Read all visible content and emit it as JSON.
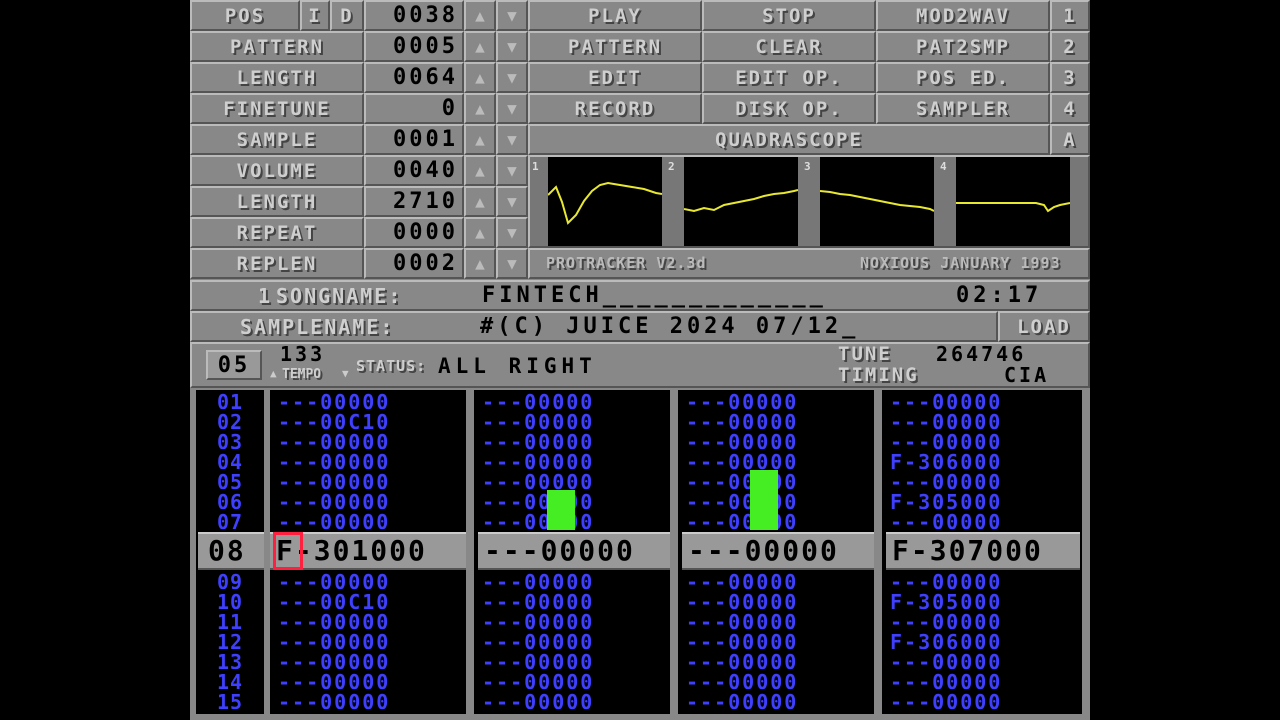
{
  "left_panel": [
    {
      "label": "POS",
      "value": "0038"
    },
    {
      "label": "PATTERN",
      "value": "0005"
    },
    {
      "label": "LENGTH",
      "value": "0064"
    },
    {
      "label": "FINETUNE",
      "value": "0"
    },
    {
      "label": "SAMPLE",
      "value": "0001"
    },
    {
      "label": "VOLUME",
      "value": "0040"
    },
    {
      "label": "LENGTH",
      "value": "2710"
    },
    {
      "label": "REPEAT",
      "value": "0000"
    },
    {
      "label": "REPLEN",
      "value": "0002"
    }
  ],
  "pos_ins": "I",
  "pos_del": "D",
  "menu": [
    [
      "PLAY",
      "STOP",
      "MOD2WAV",
      "1"
    ],
    [
      "PATTERN",
      "CLEAR",
      "PAT2SMP",
      "2"
    ],
    [
      "EDIT",
      "EDIT OP.",
      "POS ED.",
      "3"
    ],
    [
      "RECORD",
      "DISK OP.",
      "SAMPLER",
      "4"
    ]
  ],
  "quadrascope": {
    "label": "QUADRASCOPE",
    "mode": "A",
    "channels": [
      "1",
      "2",
      "3",
      "4"
    ]
  },
  "credits": {
    "left": "PROTRACKER V2.3d",
    "right": "NOXIOUS JANUARY 1993"
  },
  "song": {
    "num": "1",
    "label": "SONGNAME:",
    "name": "FINTECH_____________",
    "time": "02:17"
  },
  "sample": {
    "label": "SAMPLENAME:",
    "name": "#(C) JUICE 2024 07/12_",
    "load": "LOAD"
  },
  "status_bar": {
    "pattern": "05",
    "tempo_value": "133",
    "tempo_label": "TEMPO",
    "status_label": "STATUS:",
    "status": "ALL RIGHT",
    "tune_label": "TUNE",
    "tune_value": "264746",
    "timing_label": "TIMING",
    "timing_value": "CIA"
  },
  "pattern": {
    "rows_above": [
      "01",
      "02",
      "03",
      "04",
      "05",
      "06",
      "07"
    ],
    "current_row": "08",
    "rows_below": [
      "09",
      "10",
      "11",
      "12",
      "13",
      "14",
      "15"
    ],
    "ch1_above": [
      "---00000",
      "---00C10",
      "---00000",
      "---00000",
      "---00000",
      "---00000",
      "---00000"
    ],
    "ch1_current": "F-301000",
    "ch1_below": [
      "---00000",
      "---00C10",
      "---00000",
      "---00000",
      "---00000",
      "---00000",
      "---00000"
    ],
    "ch2_above": [
      "---00000",
      "---00000",
      "---00000",
      "---00000",
      "---00000",
      "---00000",
      "---00000"
    ],
    "ch2_current": "---00000",
    "ch2_below": [
      "---00000",
      "---00000",
      "---00000",
      "---00000",
      "---00000",
      "---00000",
      "---00000"
    ],
    "ch3_above": [
      "---00000",
      "---00000",
      "---00000",
      "---00000",
      "---00000",
      "---00000",
      "---00000"
    ],
    "ch3_current": "---00000",
    "ch3_below": [
      "---00000",
      "---00000",
      "---00000",
      "---00000",
      "---00000",
      "---00000",
      "---00000"
    ],
    "ch4_above": [
      "---00000",
      "---00000",
      "---00000",
      "F-306000",
      "---00000",
      "F-305000",
      "---00000"
    ],
    "ch4_current": "F-307000",
    "ch4_below": [
      "---00000",
      "F-305000",
      "---00000",
      "F-306000",
      "---00000",
      "---00000",
      "---00000"
    ]
  },
  "colors": {
    "panel": "#888888",
    "text_blue": "#3f3fff",
    "scope_wave": "#e8e830",
    "vu": "#44ee22",
    "cursor": "#ff2040"
  }
}
